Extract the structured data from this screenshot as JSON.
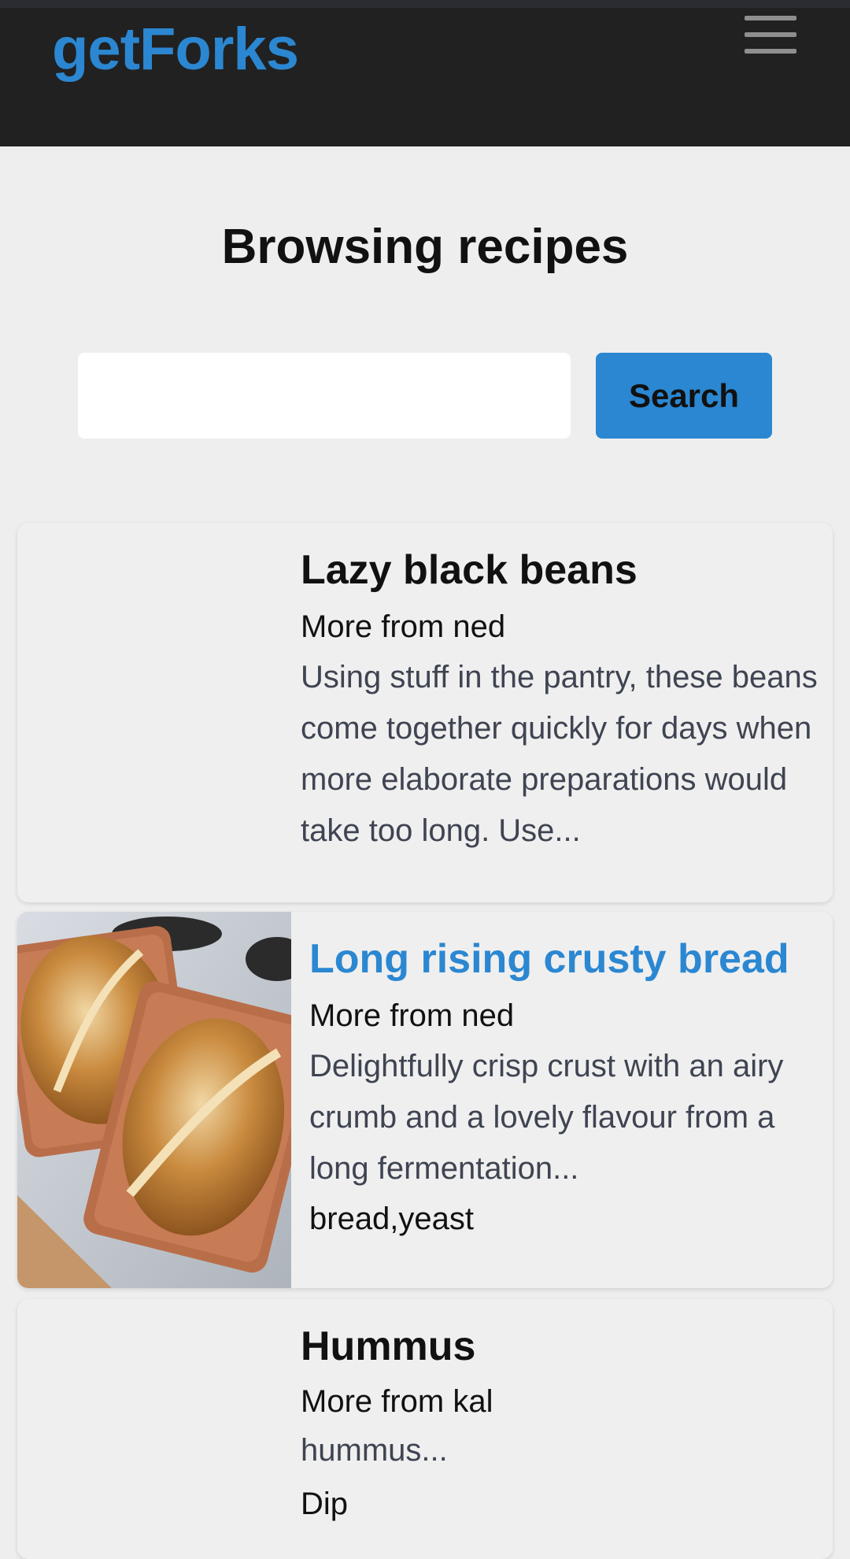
{
  "app": {
    "brand": "getForks"
  },
  "page": {
    "heading": "Browsing recipes"
  },
  "search": {
    "value": "",
    "placeholder": "",
    "button_label": "Search"
  },
  "recipes": [
    {
      "title": "Lazy black beans",
      "author": "More from ned",
      "description": "Using stuff in the pantry, these beans come together quickly for days when more elaborate preparations would take too long. Use...",
      "tags": "",
      "has_image": false
    },
    {
      "title": "Long rising crusty bread",
      "author": "More from ned",
      "description": "Delightfully crisp crust with an airy crumb and a lovely flavour from a long fermentation...",
      "tags": "bread,yeast",
      "has_image": true,
      "image_subject": "two loaves of crusty bread in copper loaf pans"
    },
    {
      "title": "Hummus",
      "author": "More from kal",
      "description": "hummus...",
      "tags": "Dip",
      "has_image": false
    }
  ],
  "colors": {
    "brand": "#2b87d1",
    "navbar": "#212121",
    "background": "#eeeeee",
    "link": "#2b87d1"
  },
  "icons": {
    "menu": "hamburger-icon"
  }
}
